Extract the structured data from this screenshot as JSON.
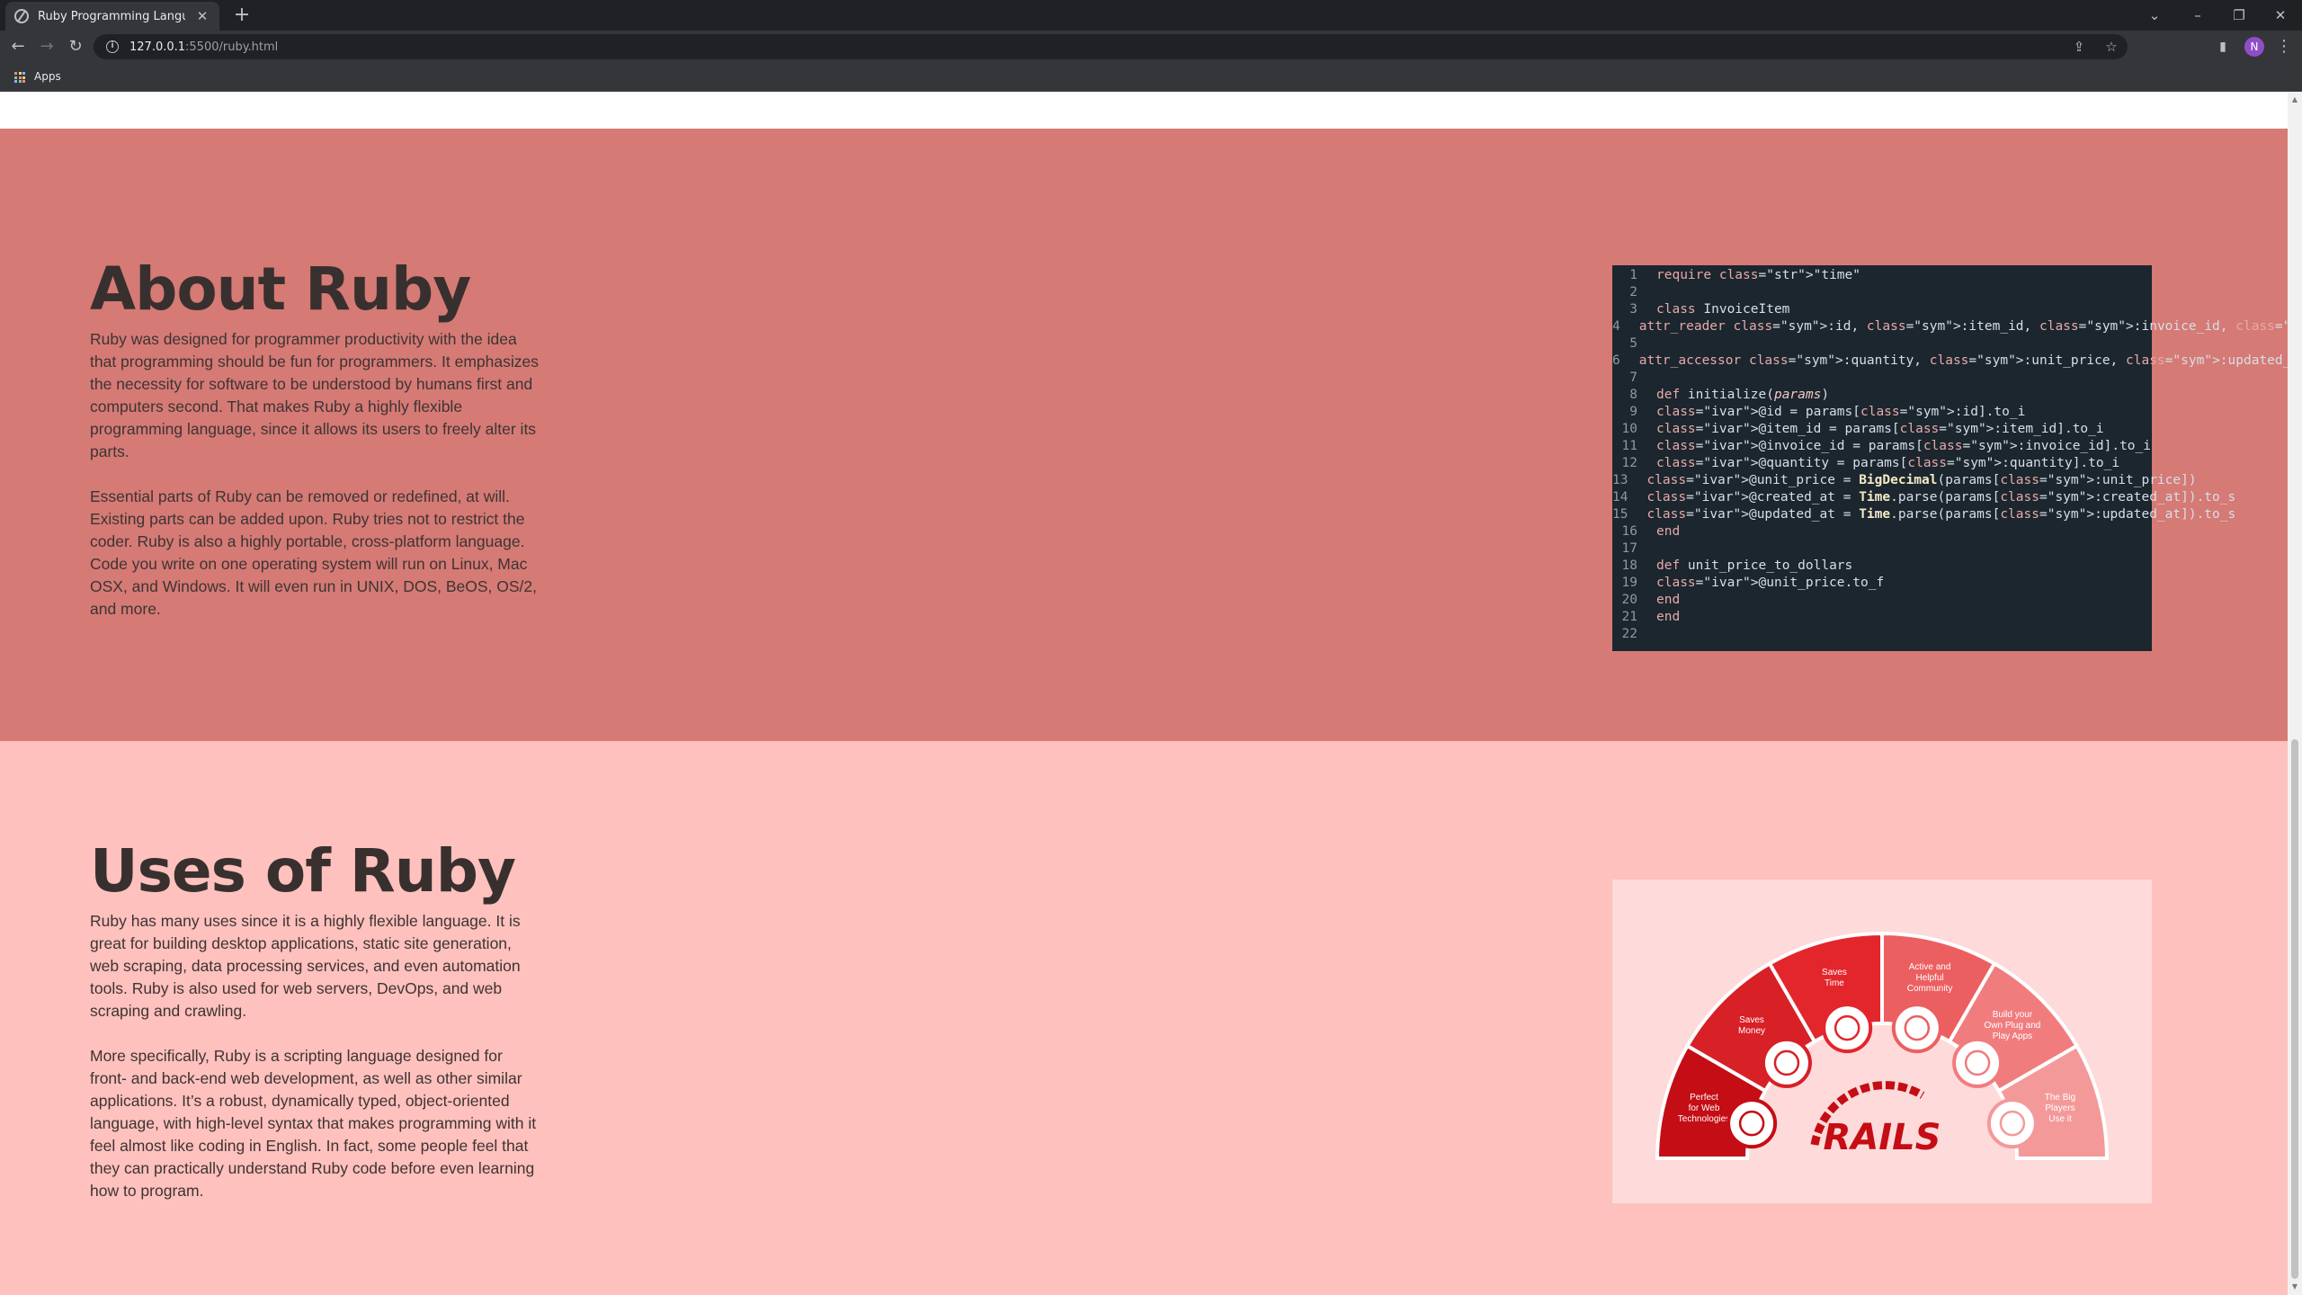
{
  "browser": {
    "tab_title": "Ruby Programming Language",
    "url_host": "127.0.0.1",
    "url_path": ":5500/ruby.html",
    "bookmark_apps": "Apps",
    "profile_initial": "N"
  },
  "about": {
    "heading": "About Ruby",
    "paragraph1": "Ruby was designed for programmer productivity with the idea that programming should be fun for programmers. It emphasizes the necessity for software to be understood by humans first and computers second. That makes Ruby a highly flexible programming language, since it allows its users to freely alter its parts.",
    "paragraph2": "Essential parts of Ruby can be removed or redefined, at will. Existing parts can be added upon. Ruby tries not to restrict the coder. Ruby is also a highly portable, cross-platform language. Code you write on one operating system will run on Linux, Mac OSX, and Windows. It will even run in UNIX, DOS, BeOS, OS/2, and more."
  },
  "code": {
    "lines": [
      "require \"time\"",
      "",
      "class InvoiceItem",
      "attr_reader :id, :item_id, :invoice_id, :created_at",
      "",
      "attr_accessor :quantity, :unit_price, :updated_at",
      "",
      "def initialize(params)",
      "@id = params[:id].to_i",
      "@item_id = params[:item_id].to_i",
      "@invoice_id = params[:invoice_id].to_i",
      "@quantity = params[:quantity].to_i",
      "@unit_price = BigDecimal(params[:unit_price])",
      "@created_at = Time.parse(params[:created_at]).to_s",
      "@updated_at = Time.parse(params[:updated_at]).to_s",
      "end",
      "",
      "def unit_price_to_dollars",
      "@unit_price.to_f",
      "end",
      "end",
      ""
    ]
  },
  "uses": {
    "heading": "Uses of Ruby",
    "paragraph1": "Ruby has many uses since it is a highly flexible language. It is great for building desktop applications, static site generation, web scraping, data processing services, and even automation tools. Ruby is also used for web servers, DevOps, and web scraping and crawling.",
    "paragraph2": "More specifically, Ruby is a scripting language designed for front- and back-end web development, as well as other similar applications. It’s a robust, dynamically typed, object-oriented language, with high-level syntax that makes programming with it feel almost like coding in English. In fact, some people feel that they can practically understand Ruby code before even learning how to program."
  },
  "infographic": {
    "logo_text": "RAILS",
    "segments": [
      {
        "label": [
          "Perfect",
          "for Web",
          "Technologies"
        ],
        "color": "#c40d14",
        "icon": "globe-icon"
      },
      {
        "label": [
          "Saves",
          "Money"
        ],
        "color": "#d82027",
        "icon": "wallet-icon"
      },
      {
        "label": [
          "Saves",
          "Time"
        ],
        "color": "#e3262c",
        "icon": "clock-icon"
      },
      {
        "label": [
          "Active and",
          "Helpful",
          "Community"
        ],
        "color": "#ec5f61",
        "icon": "community-icon"
      },
      {
        "label": [
          "Build your",
          "Own Plug and",
          "Play Apps"
        ],
        "color": "#f07c7e",
        "icon": "phone-icon"
      },
      {
        "label": [
          "The Big",
          "Players",
          "Use it"
        ],
        "color": "#f4999a",
        "icon": "person-icon"
      }
    ]
  }
}
